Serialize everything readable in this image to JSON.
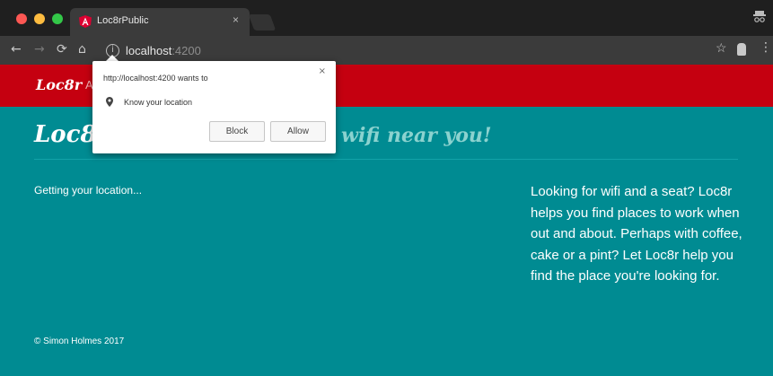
{
  "browser": {
    "tab_title": "Loc8rPublic",
    "tab_close": "×",
    "url_host": "localhost",
    "url_port": ":4200",
    "info_glyph": "i",
    "icons": [
      "back-icon",
      "forward-icon",
      "reload-icon",
      "home-icon",
      "info-icon",
      "star-icon",
      "extension-icon",
      "menu-icon"
    ]
  },
  "header": {
    "brand": "Loc8r",
    "nav_about": "A"
  },
  "hero": {
    "title": "Loc8r",
    "tagline": "wifi near you!"
  },
  "status": "Getting your location...",
  "sidebar": "Looking for wifi and a seat? Loc8r helps you find places to work when out and about. Perhaps with coffee, cake or a pint? Let Loc8r help you find the place you're looking for.",
  "footer": "© Simon Holmes 2017",
  "popup": {
    "origin": "http://localhost:4200 wants to",
    "permission": "Know your location",
    "close": "×",
    "block_label": "Block",
    "allow_label": "Allow"
  },
  "colors": {
    "header_red": "#c50010",
    "teal": "#008b92",
    "tagline": "#8bd2cf"
  }
}
